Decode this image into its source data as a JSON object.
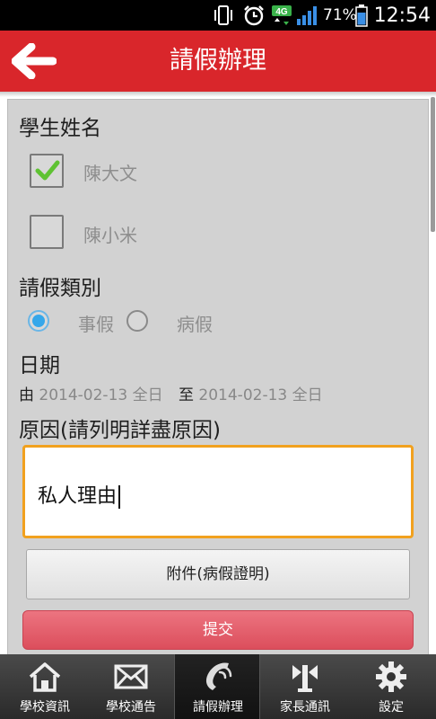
{
  "status_bar": {
    "network": "4G",
    "battery": "71%",
    "time": "12:54",
    "icons": [
      "vibrate-icon",
      "alarm-icon",
      "signal-icon",
      "battery-icon"
    ]
  },
  "header": {
    "title": "請假辦理",
    "back_icon": "back-arrow-icon",
    "bg_color": "#d9262b"
  },
  "form": {
    "student_label": "學生姓名",
    "students": [
      {
        "name": "陳大文",
        "checked": true
      },
      {
        "name": "陳小米",
        "checked": false
      }
    ],
    "leave_type_label": "請假類別",
    "leave_types": [
      {
        "label": "事假",
        "selected": true
      },
      {
        "label": "病假",
        "selected": false
      }
    ],
    "date_label": "日期",
    "date_from_prefix": "由",
    "date_from": "2014-02-13 全日",
    "date_to_prefix": "至",
    "date_to": "2014-02-13 全日",
    "reason_label": "原因(請列明詳盡原因)",
    "reason_value": "私人理由",
    "attach_button": "附件(病假證明)",
    "submit_button": "提交"
  },
  "tabs": [
    {
      "label": "學校資訊",
      "icon": "home-icon",
      "active": false
    },
    {
      "label": "學校通告",
      "icon": "mail-icon",
      "active": false
    },
    {
      "label": "請假辦理",
      "icon": "phone-icon",
      "active": true
    },
    {
      "label": "家長通訊",
      "icon": "antenna-icon",
      "active": false
    },
    {
      "label": "設定",
      "icon": "gear-icon",
      "active": false
    }
  ],
  "colors": {
    "accent": "#d9262b",
    "submit": "#dc4e5c",
    "focus_border": "#f1a11f",
    "radio_selected": "#35a7ea"
  }
}
